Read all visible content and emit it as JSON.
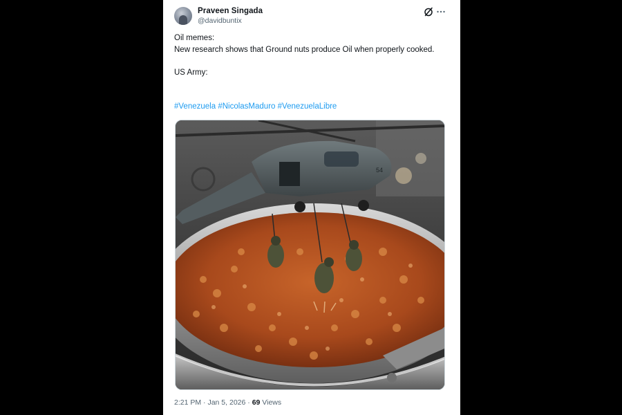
{
  "author": {
    "display_name": "Praveen Singada",
    "handle": "@davidbuntix"
  },
  "tweet": {
    "lines": [
      "Oil memes:",
      "New research shows that Ground nuts produce Oil when properly cooked.",
      "",
      "US Army:"
    ],
    "hashtags": [
      "#Venezuela",
      "#NicolasMaduro",
      "#VenezuelaLibre"
    ],
    "image_alt": "Toy military helicopter with soldiers rappelling into a pan of frying groundnuts"
  },
  "meta": {
    "time": "2:21 PM",
    "separator": "·",
    "date": "Jan 5, 2026",
    "views_count": "69",
    "views_label": "Views"
  },
  "icons": {
    "grok": "grok-icon",
    "more": "more-icon"
  },
  "colors": {
    "link": "#1d9bf0",
    "text": "#0f1419",
    "muted": "#536471",
    "background_outer": "#000000"
  }
}
